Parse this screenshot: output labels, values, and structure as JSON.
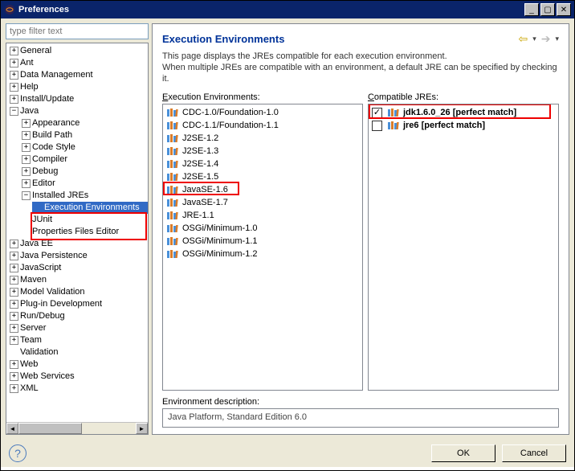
{
  "window": {
    "title": "Preferences"
  },
  "filter": {
    "placeholder": "type filter text"
  },
  "tree": {
    "general": "General",
    "ant": "Ant",
    "datamgmt": "Data Management",
    "help": "Help",
    "install": "Install/Update",
    "java": "Java",
    "appearance": "Appearance",
    "buildpath": "Build Path",
    "codestyle": "Code Style",
    "compiler": "Compiler",
    "debug": "Debug",
    "editor": "Editor",
    "installed": "Installed JREs",
    "execenv": "Execution Environments",
    "junit": "JUnit",
    "propfiles": "Properties Files Editor",
    "javaee": "Java EE",
    "javapersist": "Java Persistence",
    "javascript": "JavaScript",
    "maven": "Maven",
    "modelval": "Model Validation",
    "plugindev": "Plug-in Development",
    "rundebug": "Run/Debug",
    "server": "Server",
    "team": "Team",
    "validation": "Validation",
    "web": "Web",
    "webservices": "Web Services",
    "xml": "XML"
  },
  "page": {
    "title": "Execution Environments",
    "desc1": "This page displays the JREs compatible for each execution environment.",
    "desc2": "When multiple JREs are compatible with an environment, a default JRE can be specified by checking it.",
    "ee_label": "Execution Environments:",
    "jre_label": "Compatible JREs:",
    "env_desc_label": "Environment description:",
    "env_desc": "Java Platform, Standard Edition 6.0"
  },
  "ee": [
    "CDC-1.0/Foundation-1.0",
    "CDC-1.1/Foundation-1.1",
    "J2SE-1.2",
    "J2SE-1.3",
    "J2SE-1.4",
    "J2SE-1.5",
    "JavaSE-1.6",
    "JavaSE-1.7",
    "JRE-1.1",
    "OSGi/Minimum-1.0",
    "OSGi/Minimum-1.1",
    "OSGi/Minimum-1.2"
  ],
  "jres": {
    "0": {
      "label": "jdk1.6.0_26 [perfect match]",
      "checked": true
    },
    "1": {
      "label": "jre6 [perfect match]",
      "checked": false
    }
  },
  "buttons": {
    "ok": "OK",
    "cancel": "Cancel"
  }
}
